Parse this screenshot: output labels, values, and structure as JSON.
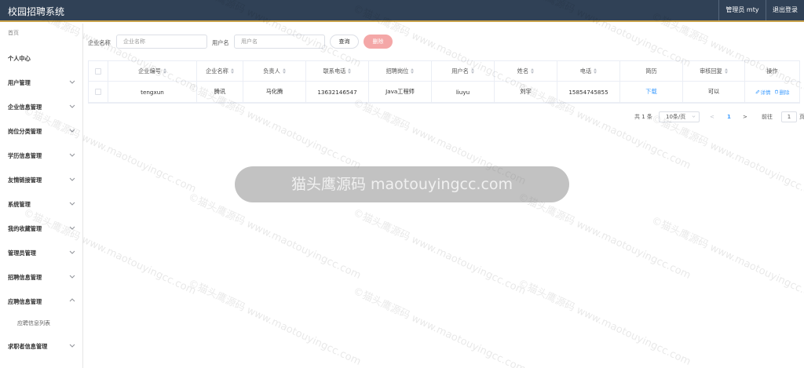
{
  "app": {
    "title": "校园招聘系统"
  },
  "header": {
    "user_label": "管理员 mty",
    "logout_label": "退出登录"
  },
  "sidebar": {
    "home_label": "首页",
    "items": [
      {
        "label": "个人中心"
      },
      {
        "label": "用户管理"
      },
      {
        "label": "企业信息管理"
      },
      {
        "label": "岗位分类管理"
      },
      {
        "label": "学历信息管理"
      },
      {
        "label": "友情链接管理"
      },
      {
        "label": "系统管理"
      },
      {
        "label": "我的收藏管理"
      },
      {
        "label": "管理员管理"
      },
      {
        "label": "招聘信息管理"
      },
      {
        "label": "应聘信息管理"
      },
      {
        "label": "求职者信息管理"
      }
    ],
    "sub_item_label": "应聘信息列表"
  },
  "search": {
    "company_name_label": "企业名称",
    "company_name_placeholder": "企业名称",
    "username_label": "用户名",
    "username_placeholder": "用户名",
    "query_button": "查询",
    "delete_button": "删除"
  },
  "table": {
    "columns": [
      "企业编号",
      "企业名称",
      "负责人",
      "联系电话",
      "招聘岗位",
      "用户名",
      "姓名",
      "电话",
      "简历",
      "审核回复",
      "操作"
    ],
    "rows": [
      {
        "company_no": "tengxun",
        "company_name": "腾讯",
        "manager": "马化腾",
        "contact_phone": "13632146547",
        "position": "Java工程师",
        "username": "liuyu",
        "name": "刘宇",
        "phone": "15854745855",
        "resume": "下载",
        "review_reply": "可以",
        "detail_label": "详情",
        "delete_label": "删除"
      }
    ]
  },
  "pagination": {
    "total_text": "共 1 条",
    "page_size": "10条/页",
    "prev": "<",
    "current_page": "1",
    "next": ">",
    "goto_label": "前往",
    "goto_value": "1",
    "page_suffix": "页"
  },
  "watermark": {
    "overlay_text": "猫头鹰源码 maotouyingcc.com",
    "repeat_text": "©猫头鹰源码 www.maotouyingcc.com"
  },
  "colors": {
    "topbar": "#304156",
    "accent": "#409eff",
    "delete_button": "#f4a7a7"
  }
}
